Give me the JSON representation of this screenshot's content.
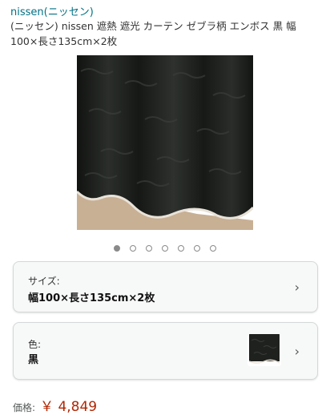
{
  "header": {
    "brand_link": "nissen(ニッセン)",
    "product_title": "(ニッセン) nissen 遮熱 遮光 カーテン ゼブラ柄 エンボス 黒 幅100×長さ135cm×2枚"
  },
  "gallery": {
    "image_name": "curtain-product-image",
    "dot_count": 7,
    "active_index": 0
  },
  "options": {
    "size": {
      "label": "サイズ:",
      "value": "幅100×長さ135cm×2枚"
    },
    "color": {
      "label": "色:",
      "value": "黒"
    }
  },
  "price": {
    "label": "価格:",
    "value": "￥ 4,849"
  },
  "colors": {
    "brand_link": "#007185",
    "price": "#B12704",
    "curtain": "#1f211f",
    "floor": "#c8b095"
  }
}
